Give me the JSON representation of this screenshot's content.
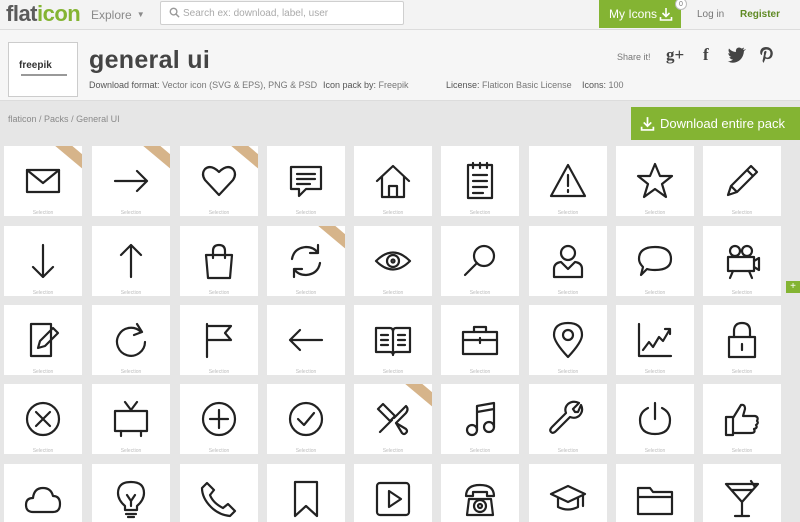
{
  "nav": {
    "logo_a": "flat",
    "logo_b": "icon",
    "explore": "Explore",
    "search_placeholder": "Search ex: download, label, user",
    "my_icons": "My Icons",
    "my_icons_count": "0",
    "login": "Log in",
    "register": "Register"
  },
  "pack": {
    "author_logo": "freepik",
    "title": "general ui",
    "download_format_label": "Download format:",
    "download_format": "Vector icon (SVG & EPS), PNG & PSD",
    "pack_by_label": "Icon pack by:",
    "pack_by": "Freepik",
    "license_label": "License:",
    "license": "Flaticon Basic License",
    "icons_label": "Icons:",
    "icons_count": "100"
  },
  "share": {
    "label": "Share it!",
    "networks": [
      "g+",
      "f",
      "twitter",
      "pinterest"
    ]
  },
  "breadcrumb": [
    "flaticon",
    "Packs",
    "General UI"
  ],
  "download_pack": "Download entire pack",
  "side_tab": "+",
  "tile_caption": "Selection",
  "icons": [
    [
      "envelope-icon",
      "right-arrow-icon",
      "heart-icon",
      "speech-bubble-icon",
      "home-icon",
      "notepad-icon",
      "warning-icon",
      "star-icon",
      "pencil-icon"
    ],
    [
      "down-arrow-icon",
      "up-arrow-icon",
      "shopping-bag-icon",
      "refresh-icon",
      "eye-icon",
      "magnifier-icon",
      "user-icon",
      "chat-bubble-icon",
      "video-camera-icon"
    ],
    [
      "edit-document-icon",
      "reload-icon",
      "flag-icon",
      "left-arrow-icon",
      "open-book-icon",
      "briefcase-icon",
      "location-pin-icon",
      "line-chart-icon",
      "padlock-icon"
    ],
    [
      "cancel-circle-icon",
      "television-icon",
      "add-circle-icon",
      "check-circle-icon",
      "tools-icon",
      "music-note-icon",
      "wrench-icon",
      "power-icon",
      "thumbs-up-icon"
    ],
    [
      "cloud-icon",
      "light-bulb-icon",
      "telephone-icon",
      "bookmark-icon",
      "play-button-icon",
      "old-phone-icon",
      "graduation-cap-icon",
      "folder-icon",
      "cocktail-icon"
    ]
  ],
  "ribbons": [
    "envelope-icon",
    "right-arrow-icon",
    "heart-icon",
    "refresh-icon",
    "tools-icon"
  ],
  "colors": {
    "accent": "#84b433",
    "ribbon": "#d6b48a"
  }
}
